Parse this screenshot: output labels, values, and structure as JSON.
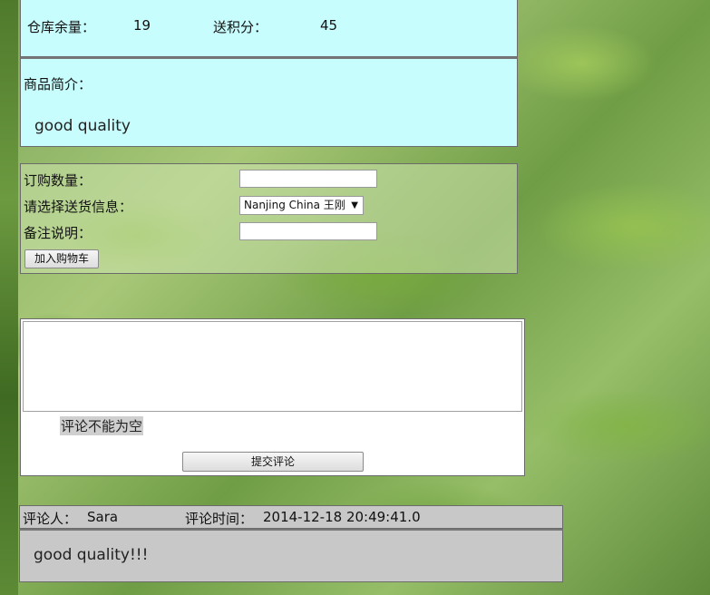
{
  "product": {
    "stock_label": "仓库余量：",
    "stock_value": "19",
    "points_label": "送积分：",
    "points_value": "45",
    "intro_label": "商品简介：",
    "intro_text": "good quality"
  },
  "order_form": {
    "quantity_label": "订购数量：",
    "quantity_value": "",
    "delivery_label": "请选择送货信息：",
    "delivery_selected": "Nanjing China 王刚",
    "note_label": "备注说明：",
    "note_value": "",
    "add_to_cart_label": "加入购物车"
  },
  "comment_form": {
    "comment_value": "",
    "error_text": "评论不能为空",
    "submit_label": "提交评论"
  },
  "reviews": [
    {
      "reviewer_label": "评论人：",
      "reviewer": "Sara",
      "time_label": "评论时间：",
      "time": "2014-12-18 20:49:41.0",
      "text": "good quality!!!"
    }
  ],
  "colors": {
    "panel_cyan": "#c8fdfd",
    "panel_gray": "#c8c8c8",
    "background_theme": "green leaves with water drops"
  }
}
